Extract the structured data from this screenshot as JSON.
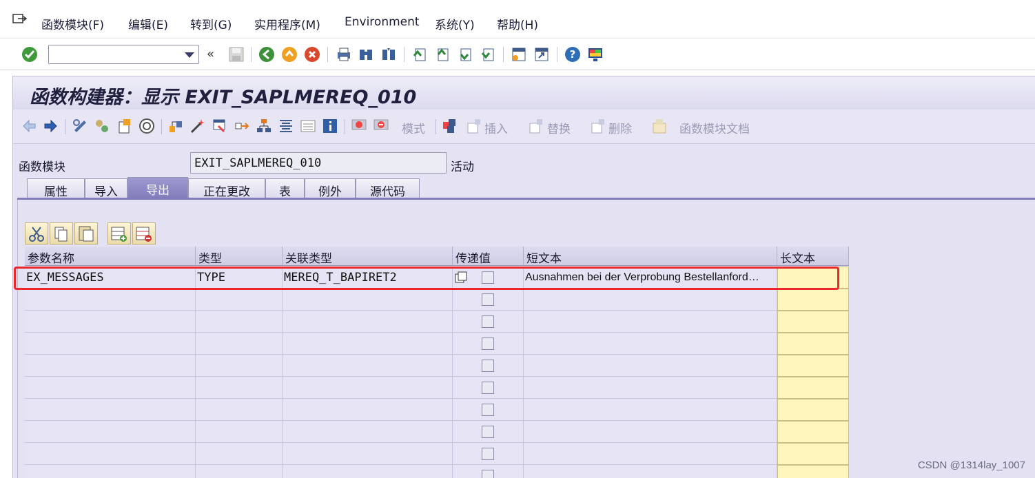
{
  "menu": {
    "items": [
      "函数模块(F)",
      "编辑(E)",
      "转到(G)",
      "实用程序(M)",
      "Environment",
      "系统(Y)",
      "帮助(H)"
    ]
  },
  "toolbar": {
    "command_field_value": "",
    "icons": [
      "enter-icon",
      "back-chevron-icon",
      "save-icon",
      "back-icon",
      "exit-icon",
      "cancel-icon",
      "print-icon",
      "find-icon",
      "find-next-icon",
      "first-page-icon",
      "previous-page-icon",
      "next-page-icon",
      "last-page-icon",
      "new-session-icon",
      "shortcut-icon",
      "help-icon",
      "customize-layout-icon"
    ]
  },
  "page": {
    "title": "函数构建器：显示 EXIT_SAPLMEREQ_010"
  },
  "app_toolbar": {
    "mode_label": "模式",
    "insert_label": "插入",
    "replace_label": "替换",
    "delete_label": "删除",
    "doc_label": "函数模块文档"
  },
  "header": {
    "function_module_label": "函数模块",
    "function_module_value": "EXIT_SAPLMEREQ_010",
    "status": "活动"
  },
  "tabs": [
    {
      "label": "属性",
      "active": false
    },
    {
      "label": "导入",
      "active": false
    },
    {
      "label": "导出",
      "active": true
    },
    {
      "label": "正在更改",
      "active": false
    },
    {
      "label": "表",
      "active": false
    },
    {
      "label": "例外",
      "active": false
    },
    {
      "label": "源代码",
      "active": false
    }
  ],
  "table": {
    "columns": [
      "参数名称",
      "类型",
      "关联类型",
      "传递值",
      "短文本",
      "长文本"
    ],
    "rows": [
      {
        "param": "EX_MESSAGES",
        "type": "TYPE",
        "assoc_type": "MEREQ_T_BAPIRET2",
        "pass_value": false,
        "short_text": "Ausnahmen bei der Verprobung Bestellanford…",
        "long_text": ""
      }
    ],
    "empty_rows": 9
  },
  "colors": {
    "accent_tab": "#7f7cb9",
    "highlight": "#e8282b",
    "long_text_cell": "#fff6be"
  },
  "watermark": "CSDN @1314lay_1007"
}
